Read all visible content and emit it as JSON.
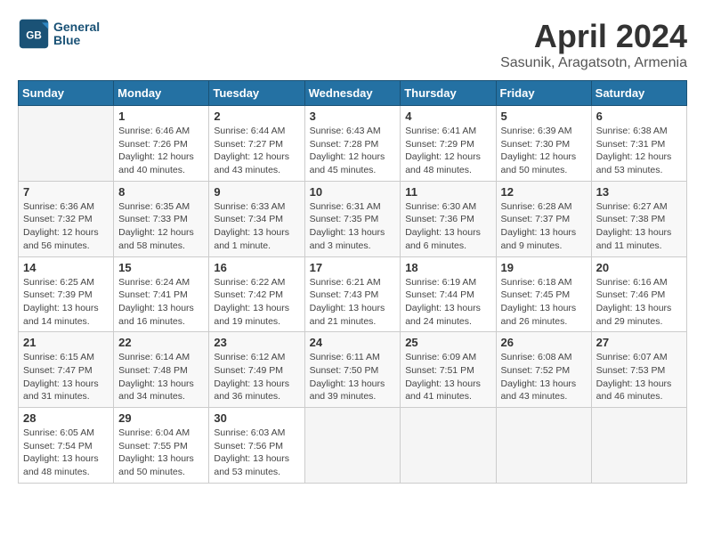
{
  "header": {
    "logo_line1": "General",
    "logo_line2": "Blue",
    "month": "April 2024",
    "location": "Sasunik, Aragatsotn, Armenia"
  },
  "weekdays": [
    "Sunday",
    "Monday",
    "Tuesday",
    "Wednesday",
    "Thursday",
    "Friday",
    "Saturday"
  ],
  "weeks": [
    [
      {
        "day": "",
        "info": ""
      },
      {
        "day": "1",
        "info": "Sunrise: 6:46 AM\nSunset: 7:26 PM\nDaylight: 12 hours\nand 40 minutes."
      },
      {
        "day": "2",
        "info": "Sunrise: 6:44 AM\nSunset: 7:27 PM\nDaylight: 12 hours\nand 43 minutes."
      },
      {
        "day": "3",
        "info": "Sunrise: 6:43 AM\nSunset: 7:28 PM\nDaylight: 12 hours\nand 45 minutes."
      },
      {
        "day": "4",
        "info": "Sunrise: 6:41 AM\nSunset: 7:29 PM\nDaylight: 12 hours\nand 48 minutes."
      },
      {
        "day": "5",
        "info": "Sunrise: 6:39 AM\nSunset: 7:30 PM\nDaylight: 12 hours\nand 50 minutes."
      },
      {
        "day": "6",
        "info": "Sunrise: 6:38 AM\nSunset: 7:31 PM\nDaylight: 12 hours\nand 53 minutes."
      }
    ],
    [
      {
        "day": "7",
        "info": "Sunrise: 6:36 AM\nSunset: 7:32 PM\nDaylight: 12 hours\nand 56 minutes."
      },
      {
        "day": "8",
        "info": "Sunrise: 6:35 AM\nSunset: 7:33 PM\nDaylight: 12 hours\nand 58 minutes."
      },
      {
        "day": "9",
        "info": "Sunrise: 6:33 AM\nSunset: 7:34 PM\nDaylight: 13 hours\nand 1 minute."
      },
      {
        "day": "10",
        "info": "Sunrise: 6:31 AM\nSunset: 7:35 PM\nDaylight: 13 hours\nand 3 minutes."
      },
      {
        "day": "11",
        "info": "Sunrise: 6:30 AM\nSunset: 7:36 PM\nDaylight: 13 hours\nand 6 minutes."
      },
      {
        "day": "12",
        "info": "Sunrise: 6:28 AM\nSunset: 7:37 PM\nDaylight: 13 hours\nand 9 minutes."
      },
      {
        "day": "13",
        "info": "Sunrise: 6:27 AM\nSunset: 7:38 PM\nDaylight: 13 hours\nand 11 minutes."
      }
    ],
    [
      {
        "day": "14",
        "info": "Sunrise: 6:25 AM\nSunset: 7:39 PM\nDaylight: 13 hours\nand 14 minutes."
      },
      {
        "day": "15",
        "info": "Sunrise: 6:24 AM\nSunset: 7:41 PM\nDaylight: 13 hours\nand 16 minutes."
      },
      {
        "day": "16",
        "info": "Sunrise: 6:22 AM\nSunset: 7:42 PM\nDaylight: 13 hours\nand 19 minutes."
      },
      {
        "day": "17",
        "info": "Sunrise: 6:21 AM\nSunset: 7:43 PM\nDaylight: 13 hours\nand 21 minutes."
      },
      {
        "day": "18",
        "info": "Sunrise: 6:19 AM\nSunset: 7:44 PM\nDaylight: 13 hours\nand 24 minutes."
      },
      {
        "day": "19",
        "info": "Sunrise: 6:18 AM\nSunset: 7:45 PM\nDaylight: 13 hours\nand 26 minutes."
      },
      {
        "day": "20",
        "info": "Sunrise: 6:16 AM\nSunset: 7:46 PM\nDaylight: 13 hours\nand 29 minutes."
      }
    ],
    [
      {
        "day": "21",
        "info": "Sunrise: 6:15 AM\nSunset: 7:47 PM\nDaylight: 13 hours\nand 31 minutes."
      },
      {
        "day": "22",
        "info": "Sunrise: 6:14 AM\nSunset: 7:48 PM\nDaylight: 13 hours\nand 34 minutes."
      },
      {
        "day": "23",
        "info": "Sunrise: 6:12 AM\nSunset: 7:49 PM\nDaylight: 13 hours\nand 36 minutes."
      },
      {
        "day": "24",
        "info": "Sunrise: 6:11 AM\nSunset: 7:50 PM\nDaylight: 13 hours\nand 39 minutes."
      },
      {
        "day": "25",
        "info": "Sunrise: 6:09 AM\nSunset: 7:51 PM\nDaylight: 13 hours\nand 41 minutes."
      },
      {
        "day": "26",
        "info": "Sunrise: 6:08 AM\nSunset: 7:52 PM\nDaylight: 13 hours\nand 43 minutes."
      },
      {
        "day": "27",
        "info": "Sunrise: 6:07 AM\nSunset: 7:53 PM\nDaylight: 13 hours\nand 46 minutes."
      }
    ],
    [
      {
        "day": "28",
        "info": "Sunrise: 6:05 AM\nSunset: 7:54 PM\nDaylight: 13 hours\nand 48 minutes."
      },
      {
        "day": "29",
        "info": "Sunrise: 6:04 AM\nSunset: 7:55 PM\nDaylight: 13 hours\nand 50 minutes."
      },
      {
        "day": "30",
        "info": "Sunrise: 6:03 AM\nSunset: 7:56 PM\nDaylight: 13 hours\nand 53 minutes."
      },
      {
        "day": "",
        "info": ""
      },
      {
        "day": "",
        "info": ""
      },
      {
        "day": "",
        "info": ""
      },
      {
        "day": "",
        "info": ""
      }
    ]
  ]
}
